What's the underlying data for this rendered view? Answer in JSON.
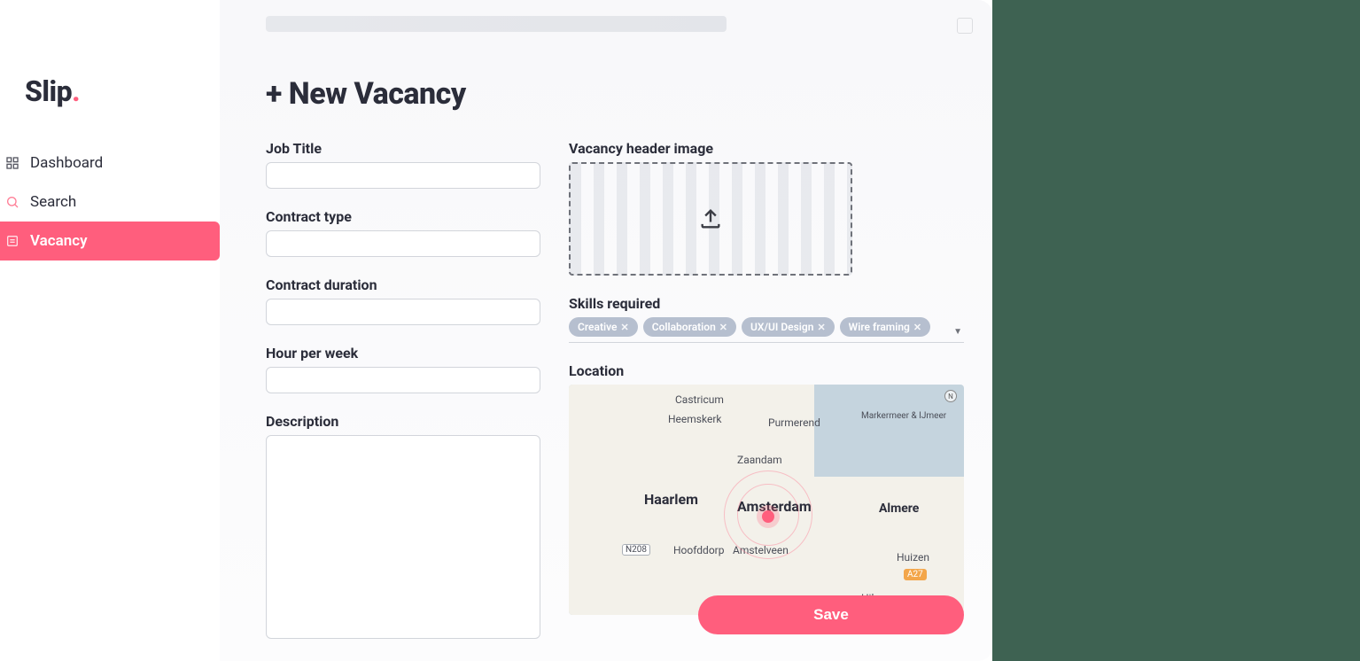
{
  "brand": {
    "name": "Slip",
    "dot": "."
  },
  "sidebar": {
    "items": [
      {
        "label": "Dashboard",
        "active": false
      },
      {
        "label": "Search",
        "active": false
      },
      {
        "label": "Vacancy",
        "active": true
      }
    ]
  },
  "page": {
    "title": "+ New Vacancy",
    "save_label": "Save"
  },
  "form": {
    "job_title": {
      "label": "Job Title",
      "value": ""
    },
    "contract_type": {
      "label": "Contract type",
      "value": ""
    },
    "contract_duration": {
      "label": "Contract duration",
      "value": ""
    },
    "hours_per_week": {
      "label": "Hour per week",
      "value": ""
    },
    "description": {
      "label": "Description",
      "value": ""
    },
    "header_image": {
      "label": "Vacancy header image"
    },
    "skills": {
      "label": "Skills required",
      "tags": [
        "Creative",
        "Collaboration",
        "UX/UI Design",
        "Wire framing"
      ]
    },
    "location": {
      "label": "Location",
      "cities": {
        "castricum": "Castricum",
        "heemskerk": "Heemskerk",
        "purmerend": "Purmerend",
        "markermeer": "Markermeer & IJmeer",
        "zaandam": "Zaandam",
        "haarlem": "Haarlem",
        "amsterdam": "Amsterdam",
        "almere": "Almere",
        "hoofddorp": "Hoofddorp",
        "amstelveen": "Amstelveen",
        "huizen": "Huizen",
        "hilversum": "Hilversum"
      },
      "roads": {
        "n208": "N208",
        "a27": "A27"
      }
    }
  }
}
